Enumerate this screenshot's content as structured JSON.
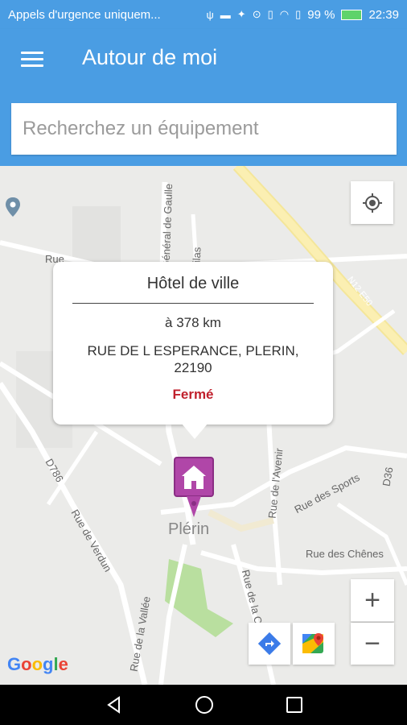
{
  "status_bar": {
    "carrier": "Appels d'urgence uniquem...",
    "battery": "99 %",
    "time": "22:39"
  },
  "app_bar": {
    "title": "Autour de moi",
    "menu_icon": "menu-icon"
  },
  "search": {
    "placeholder": "Recherchez un équipement",
    "value": ""
  },
  "map": {
    "street_labels": [
      "Rue",
      "Général de Gaulle",
      "Lilas",
      "N12 E50",
      "D786",
      "Rue de Verdun",
      "Rue de l'Avenir",
      "Rue des Sports",
      "D36",
      "Rue des Chênes",
      "Rue de la Croix",
      "Rue de la Vallée"
    ],
    "town_label": "Plérin",
    "attribution": "Google"
  },
  "popup": {
    "title": "Hôtel de ville",
    "distance": "à 378 km",
    "address": "RUE DE L ESPERANCE, PLERIN, 22190",
    "status": "Fermé",
    "status_color": "#c0202c"
  },
  "controls": {
    "zoom_in": "+",
    "zoom_out": "−"
  },
  "colors": {
    "primary": "#4a9de3",
    "marker": "#b046a8"
  }
}
